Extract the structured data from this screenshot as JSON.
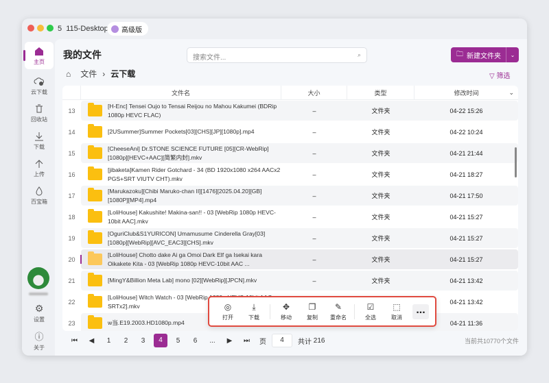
{
  "app": {
    "name": "115-Desktop",
    "tier": "高级版"
  },
  "sidebar": {
    "items": [
      {
        "label": "主页",
        "icon": "home-icon"
      },
      {
        "label": "云下载",
        "icon": "cloud-download-icon"
      },
      {
        "label": "回收站",
        "icon": "trash-icon"
      },
      {
        "label": "下载",
        "icon": "download-icon"
      },
      {
        "label": "上传",
        "icon": "upload-icon"
      },
      {
        "label": "百宝箱",
        "icon": "toolbox-icon"
      }
    ],
    "settings": "设置",
    "about": "关于"
  },
  "header": {
    "title": "我的文件",
    "search_placeholder": "搜索文件...",
    "new_folder": "新建文件夹",
    "filter": "筛选"
  },
  "breadcrumb": {
    "root": "文件",
    "sep": "›",
    "current": "云下载"
  },
  "table": {
    "columns": [
      "文件名",
      "大小",
      "类型",
      "修改时间"
    ],
    "rows": [
      {
        "n": "13",
        "name": "[H-Enc] Tensei Oujo to Tensai Reijou no Mahou Kakumei (BDRip 1080p HEVC FLAC)",
        "size": "–",
        "type": "文件夹",
        "time": "04-22 15:26"
      },
      {
        "n": "14",
        "name": "[2USummer]Summer Pockets[03][CHS][JP][1080p].mp4",
        "size": "–",
        "type": "文件夹",
        "time": "04-22 10:24"
      },
      {
        "n": "15",
        "name": "[CheeseAni] Dr.STONE SCIENCE FUTURE [05][CR-WebRip][1080p][HEVC+AAC][简繁内封].mkv",
        "size": "–",
        "type": "文件夹",
        "time": "04-21 21:44"
      },
      {
        "n": "16",
        "name": "[jibaketa]Kamen Rider Gotchard - 34 (BD 1920x1080 x264 AACx2 PGS+SRT VIUTV CHT).mkv",
        "size": "–",
        "type": "文件夹",
        "time": "04-21 18:27"
      },
      {
        "n": "17",
        "name": "[Marukazoku][Chibi Maruko-chan II][1476][2025.04.20][GB][1080P][MP4].mp4",
        "size": "–",
        "type": "文件夹",
        "time": "04-21 17:50"
      },
      {
        "n": "18",
        "name": "[LoliHouse] Kakushite! Makina-san!! - 03 [WebRip 1080p HEVC-10bit AAC].mkv",
        "size": "–",
        "type": "文件夹",
        "time": "04-21 15:27"
      },
      {
        "n": "19",
        "name": "[OguriClub&S1YURICON] Umamusume Cinderella Gray[03][1080p][WebRip][AVC_EAC3][CHS].mkv",
        "size": "–",
        "type": "文件夹",
        "time": "04-21 15:27"
      },
      {
        "n": "20",
        "name": "[LoliHouse] Chotto dake Ai ga Omoi Dark Elf ga Isekai kara Oikakete Kita - 03 [WebRip 1080p HEVC-10bit AAC ...",
        "size": "–",
        "type": "文件夹",
        "time": "04-21 15:27"
      },
      {
        "n": "21",
        "name": "[MingY&Billion Meta Lab] mono [02][WebRip][JPCN].mkv",
        "size": "–",
        "type": "文件夹",
        "time": "04-21 13:42"
      },
      {
        "n": "22",
        "name": "[LoliHouse] Witch Watch - 03 [WebRip 1080p HEVC-10bit AAC SRTx2].mkv",
        "size": "–",
        "type": "文件夹",
        "time": "04-21 13:42"
      },
      {
        "n": "23",
        "name": "w当.E19.2003.HD1080p.mp4",
        "size": "–",
        "type": "文件夹",
        "time": "04-21 11:36"
      }
    ]
  },
  "actions": [
    {
      "label": "打开",
      "g": "◎"
    },
    {
      "label": "下载",
      "g": "⤓"
    },
    {
      "label": "移动",
      "g": "✥"
    },
    {
      "label": "复制",
      "g": "❐"
    },
    {
      "label": "重命名",
      "g": "✎"
    },
    {
      "label": "全选",
      "g": "☑"
    },
    {
      "label": "取消",
      "g": "⬚"
    }
  ],
  "more": "...",
  "pager": {
    "pages": [
      "1",
      "2",
      "3",
      "4",
      "5",
      "6",
      "..."
    ],
    "current": "4",
    "page_label": "页",
    "page_value": "4",
    "total_label": "共计",
    "total": "216",
    "summary": "当前共10770个文件"
  },
  "colors": {
    "accent": "#9b2c93",
    "highlight": "#e04a3f"
  }
}
